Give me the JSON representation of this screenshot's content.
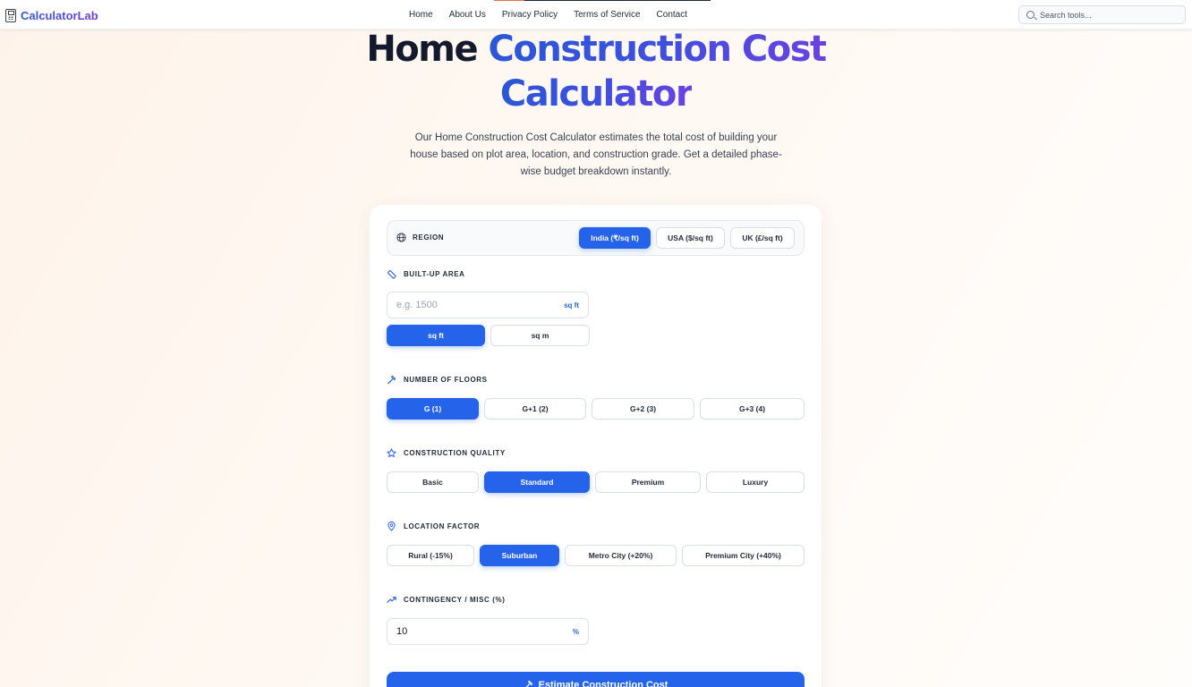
{
  "nav": {
    "brand": "CalculatorLab",
    "links": [
      "Home",
      "About Us",
      "Privacy Policy",
      "Terms of Service",
      "Contact"
    ],
    "search_placeholder": "Search tools..."
  },
  "hero": {
    "title_dark": "Home",
    "title_grad_1": "Construction Cost",
    "title_grad_2": "Calculator",
    "description": "Our Home Construction Cost Calculator estimates the total cost of building your house based on plot area, location, and construction grade. Get a detailed phase-wise budget breakdown instantly."
  },
  "form": {
    "region": {
      "label": "REGION",
      "options": [
        "India (₹/sq ft)",
        "USA ($/sq ft)",
        "UK (£/sq ft)"
      ],
      "selected": "India (₹/sq ft)"
    },
    "area": {
      "label": "BUILT-UP AREA",
      "placeholder": "e.g. 1500",
      "value": "",
      "unit_suffix": "sq ft",
      "units": [
        "sq ft",
        "sq m"
      ],
      "selected_unit": "sq ft"
    },
    "floors": {
      "label": "NUMBER OF FLOORS",
      "options": [
        "G (1)",
        "G+1 (2)",
        "G+2 (3)",
        "G+3 (4)"
      ],
      "selected": "G (1)"
    },
    "quality": {
      "label": "CONSTRUCTION QUALITY",
      "options": [
        "Basic",
        "Standard",
        "Premium",
        "Luxury"
      ],
      "selected": "Standard"
    },
    "location": {
      "label": "LOCATION FACTOR",
      "options": [
        "Rural (-15%)",
        "Suburban",
        "Metro City (+20%)",
        "Premium City (+40%)"
      ],
      "selected": "Suburban"
    },
    "contingency": {
      "label": "CONTINGENCY / MISC (%)",
      "value": "10",
      "unit_suffix": "%"
    },
    "submit_label": "Estimate Construction Cost"
  },
  "colors": {
    "accent": "#2563eb",
    "brand_gradient_start": "#2a57d8",
    "brand_gradient_end": "#6a42e4",
    "title_dark": "#141a2e"
  }
}
